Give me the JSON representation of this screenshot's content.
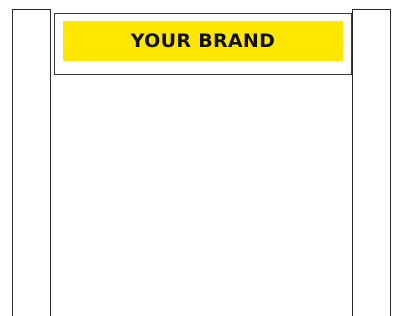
{
  "brand": {
    "text": "YOUR BRAND",
    "background_color": "#FFE800",
    "text_color": "#111111"
  },
  "palette": {
    "line_color": "#2b2b2b",
    "page_background": "#ffffff"
  }
}
